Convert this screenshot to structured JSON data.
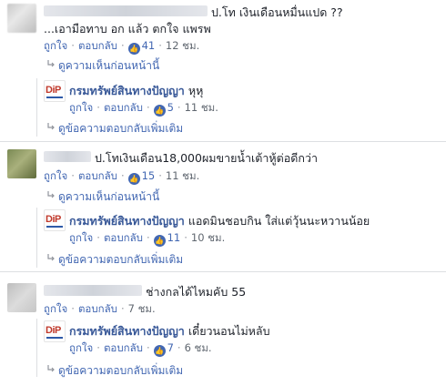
{
  "actions": {
    "like": "ถูกใจ",
    "reply": "ตอบกลับ",
    "like_icon": "thumbs-up-icon"
  },
  "threads": [
    {
      "comment": {
        "text": "ป.โท เงินเดือนหมื่นแปด ??",
        "text2": "...เอามือทาบ อก แล้ว ตกใจ แพรพ",
        "likes": "41",
        "time": "12 ชม."
      },
      "view_previous": "ดูความเห็นก่อนหน้านี้",
      "reply": {
        "page": "กรมทรัพย์สินทางปัญญา",
        "text": "หุหุ",
        "likes": "5",
        "time": "11 ชม."
      },
      "more": "ดูข้อความตอบกลับเพิ่มเติม"
    },
    {
      "comment": {
        "text": "ป.โทเงินเดือน18,000ผมขายน้ำเต้าหู้ต่อดีกว่า",
        "likes": "15",
        "time": "11 ชม."
      },
      "view_previous": "ดูความเห็นก่อนหน้านี้",
      "reply": {
        "page": "กรมทรัพย์สินทางปัญญา",
        "text": "แอดมินชอบกิน ใส่แต่วุ้นนะหวานน้อย",
        "likes": "11",
        "time": "10 ชม."
      },
      "more": "ดูข้อความตอบกลับเพิ่มเติม"
    },
    {
      "comment": {
        "text": "ช่างกลได้ไหมคับ 55",
        "time": "7 ชม."
      },
      "reply": {
        "page": "กรมทรัพย์สินทางปัญญา",
        "text": "เดี๋ยวนอนไม่หลับ",
        "likes": "7",
        "time": "6 ชม."
      },
      "more": "ดูข้อความตอบกลับเพิ่มเติม"
    }
  ]
}
